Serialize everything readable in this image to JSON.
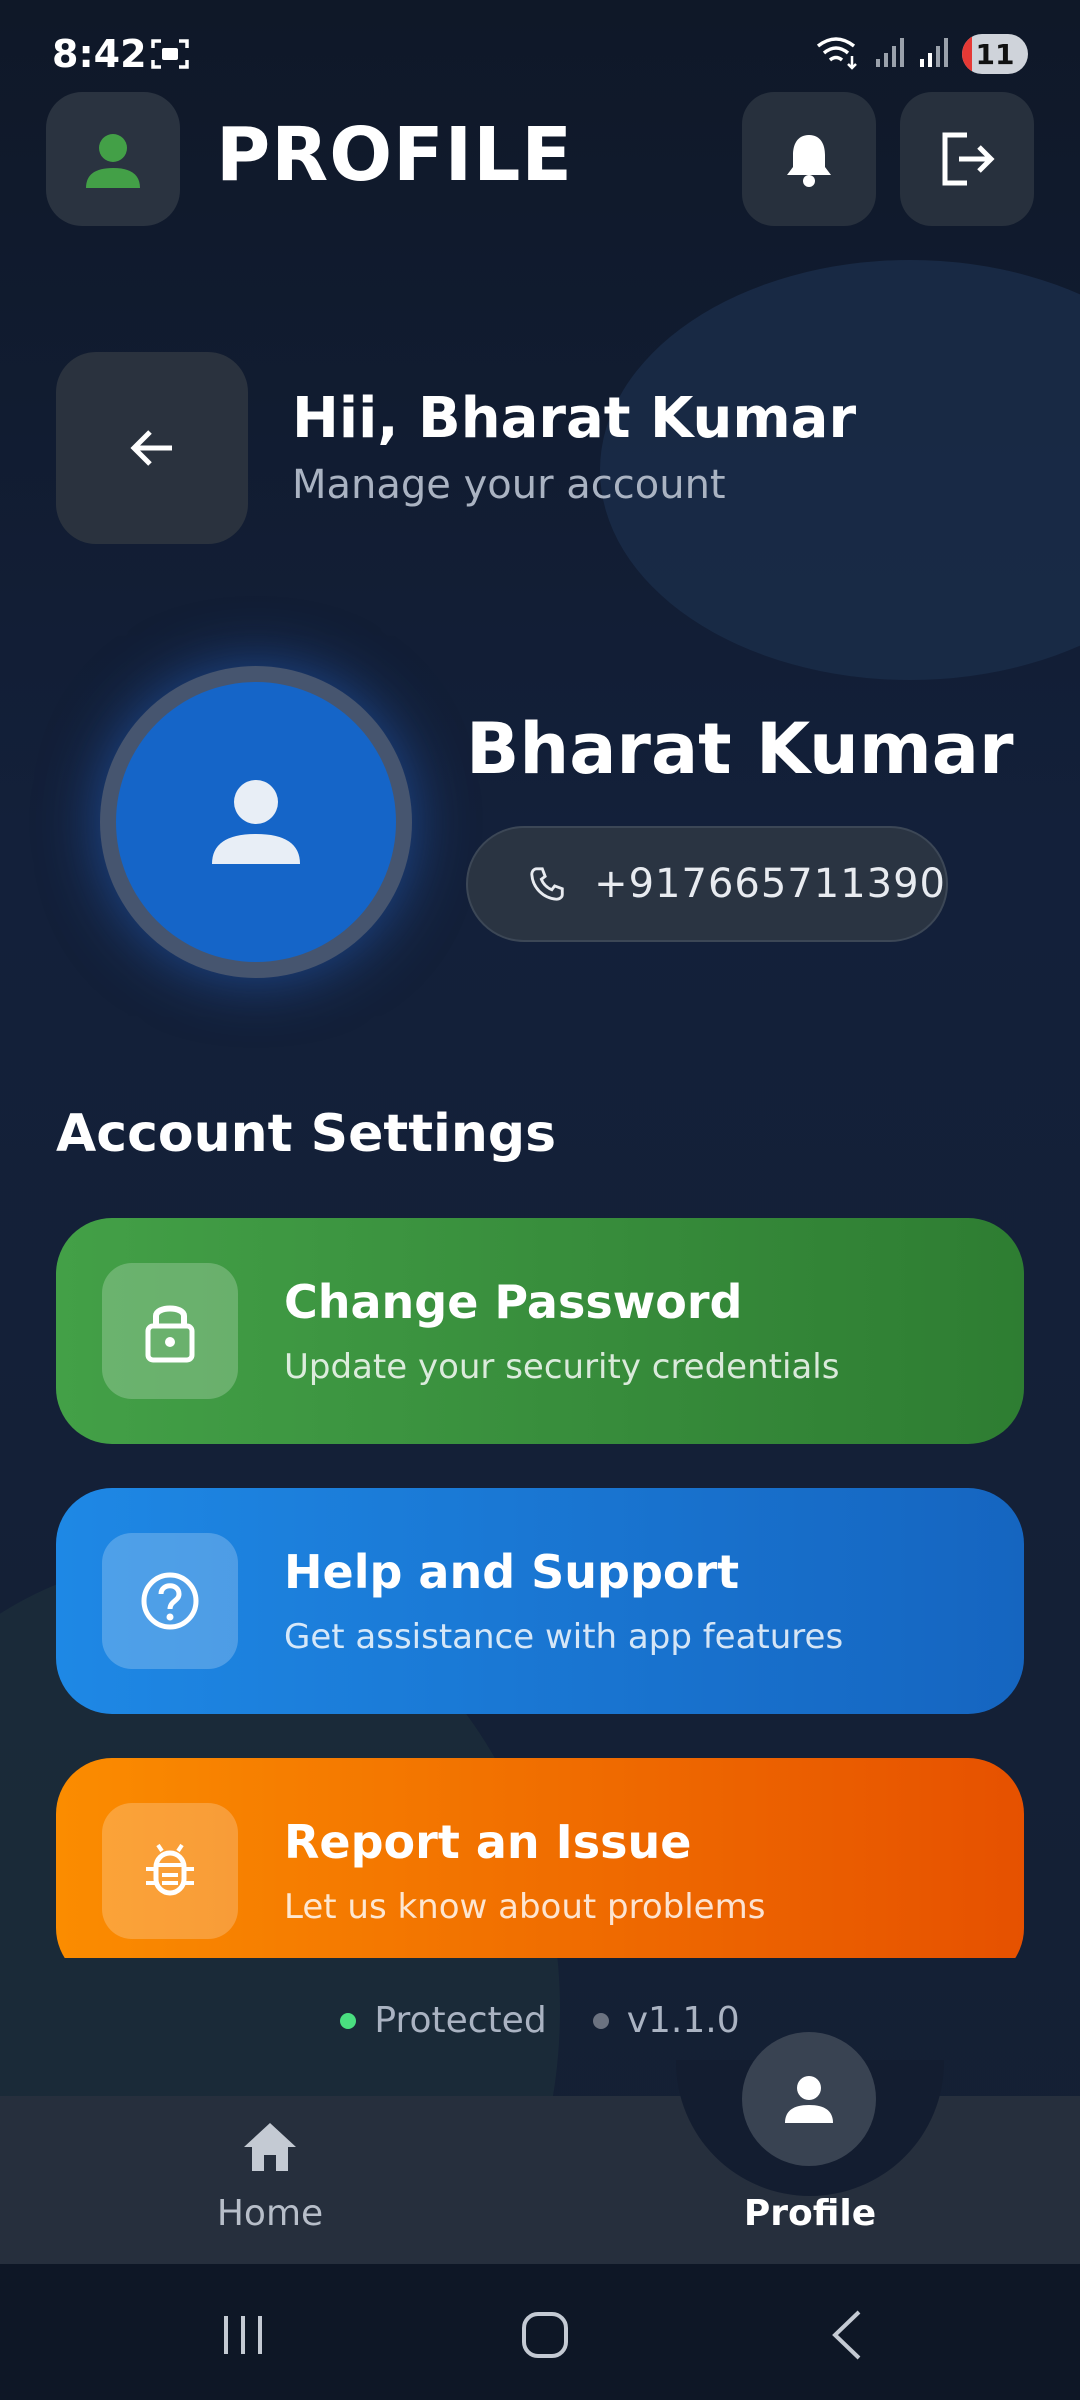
{
  "status_bar": {
    "time": "8:42",
    "battery": "11"
  },
  "header": {
    "title": "PROFILE"
  },
  "greeting": {
    "title": "Hii, Bharat Kumar",
    "subtitle": "Manage your account"
  },
  "profile": {
    "name": "Bharat Kumar",
    "phone": "+917665711390"
  },
  "settings": {
    "section_title": "Account Settings",
    "items": [
      {
        "title": "Change Password",
        "subtitle": "Update your security credentials",
        "icon": "lock-icon",
        "color": "#43a047"
      },
      {
        "title": "Help and Support",
        "subtitle": "Get assistance with app features",
        "icon": "help-icon",
        "color": "#1e88e5"
      },
      {
        "title": "Report an Issue",
        "subtitle": "Let us know about problems",
        "icon": "bug-icon",
        "color": "#fb8c00"
      }
    ]
  },
  "footer": {
    "status": "Protected",
    "version": "v1.1.0",
    "status_color": "#4ade80"
  },
  "bottom_nav": {
    "home_label": "Home",
    "profile_label": "Profile",
    "active": "Profile"
  }
}
